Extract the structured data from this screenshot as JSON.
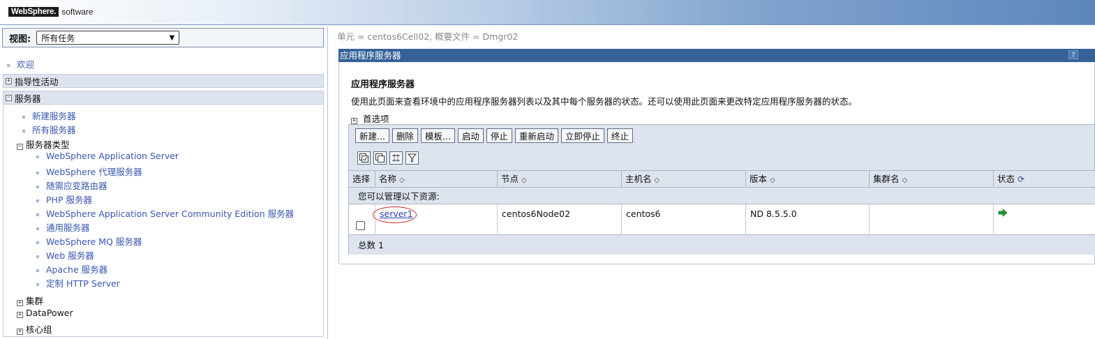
{
  "banner": {
    "logo_brand": "WebSphere.",
    "logo_suffix": "software"
  },
  "nav": {
    "view_label": "视图:",
    "view_select": "所有任务",
    "welcome": "欢迎",
    "guided": "指导性活动",
    "servers": "服务器",
    "new_server": "新建服务器",
    "all_servers": "所有服务器",
    "server_types": "服务器类型",
    "types": [
      "WebSphere Application Server",
      "WebSphere 代理服务器",
      "随需应变路由器",
      "PHP 服务器",
      "WebSphere Application Server Community Edition 服务器",
      "通用服务器",
      "WebSphere MQ 服务器",
      "Web 服务器",
      "Apache 服务器",
      "定制 HTTP Server"
    ],
    "clusters": "集群",
    "datapower": "DataPower",
    "core_group": "核心组"
  },
  "content": {
    "breadcrumb": "单元 = centos6Cell02, 概要文件 = Dmgr02",
    "pane_title": "应用程序服务器",
    "help": "?",
    "heading": "应用程序服务器",
    "description": "使用此页面来查看环境中的应用程序服务器列表以及其中每个服务器的状态。还可以使用此页面来更改特定应用程序服务器的状态。",
    "preferences": "首选项",
    "buttons": [
      "新建...",
      "删除",
      "模板...",
      "启动",
      "停止",
      "重新启动",
      "立即停止",
      "终止"
    ],
    "columns": [
      "选择",
      "名称",
      "节点",
      "主机名",
      "版本",
      "集群名",
      "状态"
    ],
    "manage_text": "您可以管理以下资源:",
    "rows": [
      {
        "name": "server1",
        "node": "centos6Node02",
        "host": "centos6",
        "version": "ND 8.5.5.0",
        "cluster": ""
      }
    ],
    "total": "总数 1"
  }
}
